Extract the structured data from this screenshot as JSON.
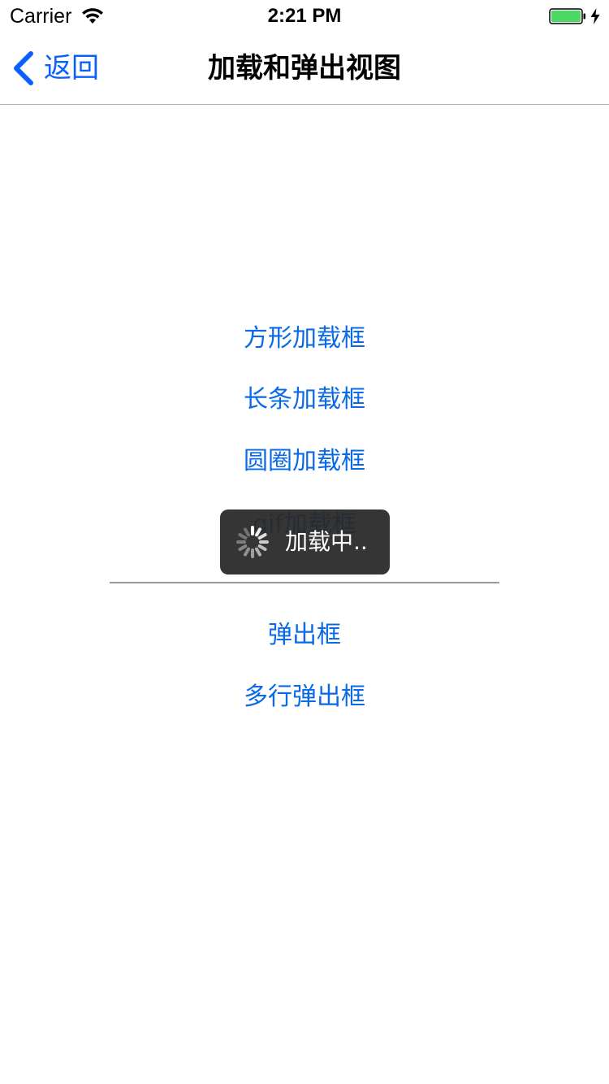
{
  "status_bar": {
    "carrier": "Carrier",
    "time": "2:21 PM",
    "wifi_icon": "wifi-icon",
    "battery_icon": "battery-icon",
    "charging_icon": "charging-bolt-icon",
    "battery_color": "#4cd964"
  },
  "nav": {
    "back_label": "返回",
    "back_icon": "chevron-left-icon",
    "title": "加载和弹出视图",
    "accent": "#0a60fe"
  },
  "menu": {
    "square_loading": "方形加载框",
    "bar_loading": "长条加载框",
    "circle_loading": "圆圈加载框",
    "gif_loading": "gif加载框",
    "popup": "弹出框",
    "multiline_popup": "多行弹出框"
  },
  "hud": {
    "label": "加载中..",
    "spinner_icon": "activity-spinner-icon"
  }
}
